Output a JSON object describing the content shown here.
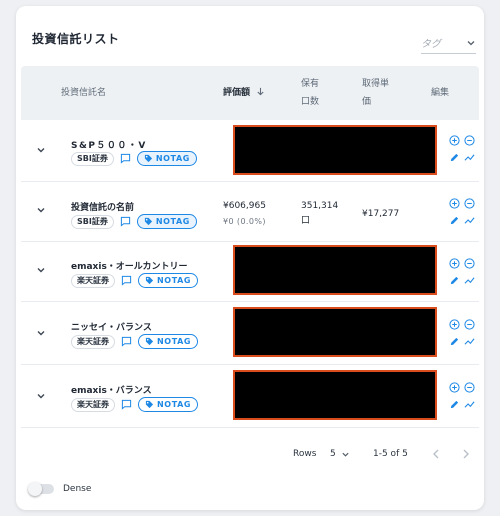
{
  "header": {
    "title": "投資信託リスト",
    "tag_placeholder": "タグ"
  },
  "columns": {
    "name": "投資信託名",
    "valuation": "評価額",
    "holding_line1": "保有",
    "holding_line2": "口数",
    "unit_line1": "取得単",
    "unit_line2": "価",
    "edit": "編集"
  },
  "rows": [
    {
      "name": "S&P５００・V",
      "broker": "SBI証券",
      "tag": "NOTAG",
      "masked": true
    },
    {
      "name": "投資信託の名前",
      "broker": "SBI証券",
      "tag": "NOTAG",
      "masked": false,
      "valuation": "¥606,965",
      "gain": "¥0 (0.0%)",
      "holding": "351,314",
      "holding_unit": "口",
      "unit_price": "¥17,277"
    },
    {
      "name": "emaxis・オールカントリー",
      "broker": "楽天証券",
      "tag": "NOTAG",
      "masked": true
    },
    {
      "name": "ニッセイ・バランス",
      "broker": "楽天証券",
      "tag": "NOTAG",
      "masked": true
    },
    {
      "name": "emaxis・バランス",
      "broker": "楽天証券",
      "tag": "NOTAG",
      "masked": true
    }
  ],
  "pagination": {
    "rows_label": "Rows",
    "rows_per_page": "5",
    "range": "1-5 of 5"
  },
  "dense_label": "Dense",
  "colors": {
    "accent": "#1e88e5",
    "mask_border": "#d84c1e",
    "header_bg": "#eef1f4"
  }
}
